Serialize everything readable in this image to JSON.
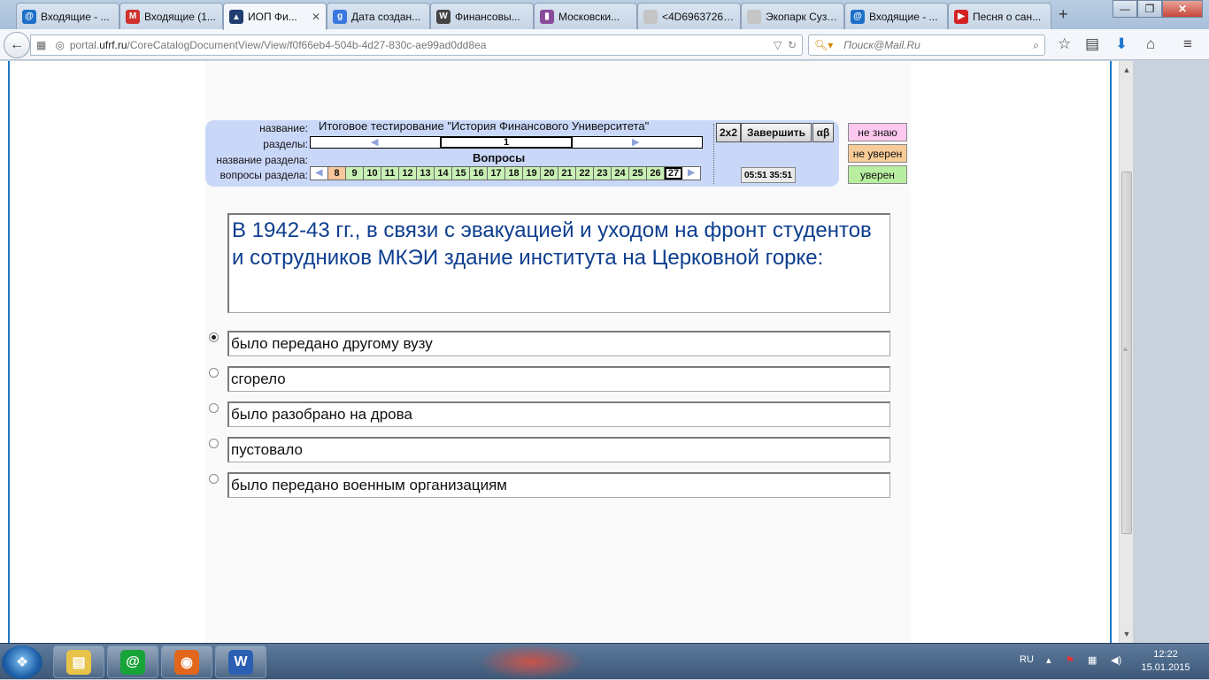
{
  "browser": {
    "tabs": [
      {
        "label": "Входящие - ...",
        "icon": "mailru-at-icon",
        "color": "#1d6fc9",
        "glyph": "@"
      },
      {
        "label": "Входящие (1...",
        "icon": "gmail-icon",
        "color": "#d0312d",
        "glyph": "M"
      },
      {
        "label": "ИОП Фи...",
        "icon": "graduation-cap-icon",
        "color": "#1f3d6e",
        "glyph": "▲",
        "active": true
      },
      {
        "label": "Дата создан...",
        "icon": "google-icon",
        "color": "#3a78e0",
        "glyph": "g"
      },
      {
        "label": "Финансовы...",
        "icon": "wikipedia-icon",
        "color": "#444444",
        "glyph": "W"
      },
      {
        "label": "Московски...",
        "icon": "bars-icon",
        "color": "#8a4b9b",
        "glyph": "▮"
      },
      {
        "label": "<4D6963726F736...",
        "icon": "blank-page-icon",
        "color": "#c5c5c5",
        "glyph": ""
      },
      {
        "label": "Экопарк Суздал...",
        "icon": "blank-page-icon",
        "color": "#c5c5c5",
        "glyph": ""
      },
      {
        "label": "Входящие - ...",
        "icon": "mailru-at-icon",
        "color": "#1d6fc9",
        "glyph": "@"
      },
      {
        "label": "Песня о сан...",
        "icon": "youtube-icon",
        "color": "#d42121",
        "glyph": "▶"
      }
    ],
    "new_tab_label": "+",
    "window_buttons": {
      "minimize": "—",
      "maximize": "❐",
      "close": "✕"
    },
    "url_prefix": "portal.",
    "url_domain": "ufrf.ru",
    "url_path": "/CoreCatalogDocumentView/View/f0f66eb4-504b-4d27-830c-ae99ad0dd8ea",
    "search_placeholder": "Поиск@Mail.Ru"
  },
  "test": {
    "label_name": "название:",
    "label_sections": "разделы:",
    "label_section_name": "название раздела:",
    "label_section_questions": "вопросы раздела:",
    "title": "Итоговое тестирование \"История Финансового Университета\"",
    "current_section": "1",
    "section_name": "Вопросы",
    "questions": [
      {
        "n": "8",
        "state": "orange"
      },
      {
        "n": "9",
        "state": "green"
      },
      {
        "n": "10",
        "state": "green"
      },
      {
        "n": "11",
        "state": "green"
      },
      {
        "n": "12",
        "state": "green"
      },
      {
        "n": "13",
        "state": "green"
      },
      {
        "n": "14",
        "state": "green"
      },
      {
        "n": "15",
        "state": "green"
      },
      {
        "n": "16",
        "state": "green"
      },
      {
        "n": "17",
        "state": "green"
      },
      {
        "n": "18",
        "state": "green"
      },
      {
        "n": "19",
        "state": "green"
      },
      {
        "n": "20",
        "state": "green"
      },
      {
        "n": "21",
        "state": "green"
      },
      {
        "n": "22",
        "state": "green"
      },
      {
        "n": "23",
        "state": "green"
      },
      {
        "n": "24",
        "state": "green"
      },
      {
        "n": "25",
        "state": "green"
      },
      {
        "n": "26",
        "state": "green"
      },
      {
        "n": "27",
        "state": "current"
      }
    ],
    "btn_2x2": "2x2",
    "btn_finish": "Завершить",
    "btn_alpha": "αβ",
    "timer": "05:51  35:51",
    "confidence": {
      "dont_know": "не знаю",
      "not_sure": "не уверен",
      "sure": "уверен",
      "dont_know_color": "#fcc8f0",
      "not_sure_color": "#f8cc98",
      "sure_color": "#b8eea0"
    }
  },
  "question": {
    "text": "В 1942-43 гг., в связи с эвакуацией и уходом на фронт студентов и сотрудников МКЭИ здание института на Церковной горке:",
    "answers": [
      {
        "text": "было передано другому вузу",
        "checked": true
      },
      {
        "text": "сгорело",
        "checked": false
      },
      {
        "text": "было разобрано на дрова",
        "checked": false
      },
      {
        "text": "пустовало",
        "checked": false
      },
      {
        "text": "было передано военным организациям",
        "checked": false
      }
    ]
  },
  "taskbar": {
    "apps": [
      {
        "name": "file-explorer-icon",
        "color": "#e8c34a",
        "glyph": "▤"
      },
      {
        "name": "mailru-agent-icon",
        "color": "#17a53a",
        "glyph": "@"
      },
      {
        "name": "firefox-icon",
        "color": "#e2661c",
        "glyph": "◉"
      },
      {
        "name": "word-icon",
        "color": "#2b5fb3",
        "glyph": "W"
      }
    ],
    "lang": "RU",
    "time": "12:22",
    "date": "15.01.2015"
  }
}
